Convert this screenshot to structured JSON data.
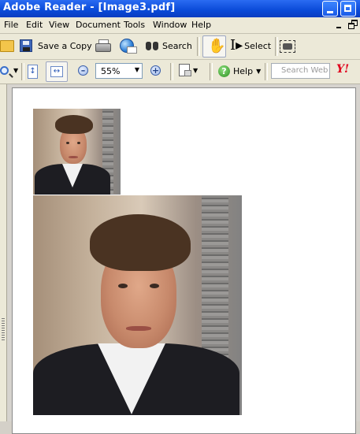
{
  "window": {
    "title": "Adobe Reader - [Image3.pdf]"
  },
  "menubar": {
    "items": [
      "File",
      "Edit",
      "View",
      "Document",
      "Tools",
      "Window",
      "Help"
    ]
  },
  "toolbar1": {
    "save_copy_label": "Save a Copy",
    "search_label": "Search",
    "select_label": "Select"
  },
  "toolbar2": {
    "zoom_value": "55%",
    "help_label": "Help",
    "search_web_placeholder": "Search Web",
    "yahoo_logo": "Y!"
  },
  "icons": {
    "open": "folder-open-icon",
    "save": "floppy-disk-icon",
    "print": "printer-icon",
    "email": "email-globe-icon",
    "search": "binoculars-icon",
    "hand": "hand-icon",
    "select": "text-select-icon",
    "snapshot": "camera-icon",
    "zoom": "magnifier-icon",
    "fit_page": "fit-page-icon",
    "fit_width": "fit-width-icon",
    "zoom_out": "zoom-out-icon",
    "zoom_in": "zoom-in-icon",
    "rotate": "rotate-icon",
    "help": "help-icon"
  },
  "document": {
    "images": [
      {
        "name": "portrait-small"
      },
      {
        "name": "portrait-large"
      }
    ]
  }
}
